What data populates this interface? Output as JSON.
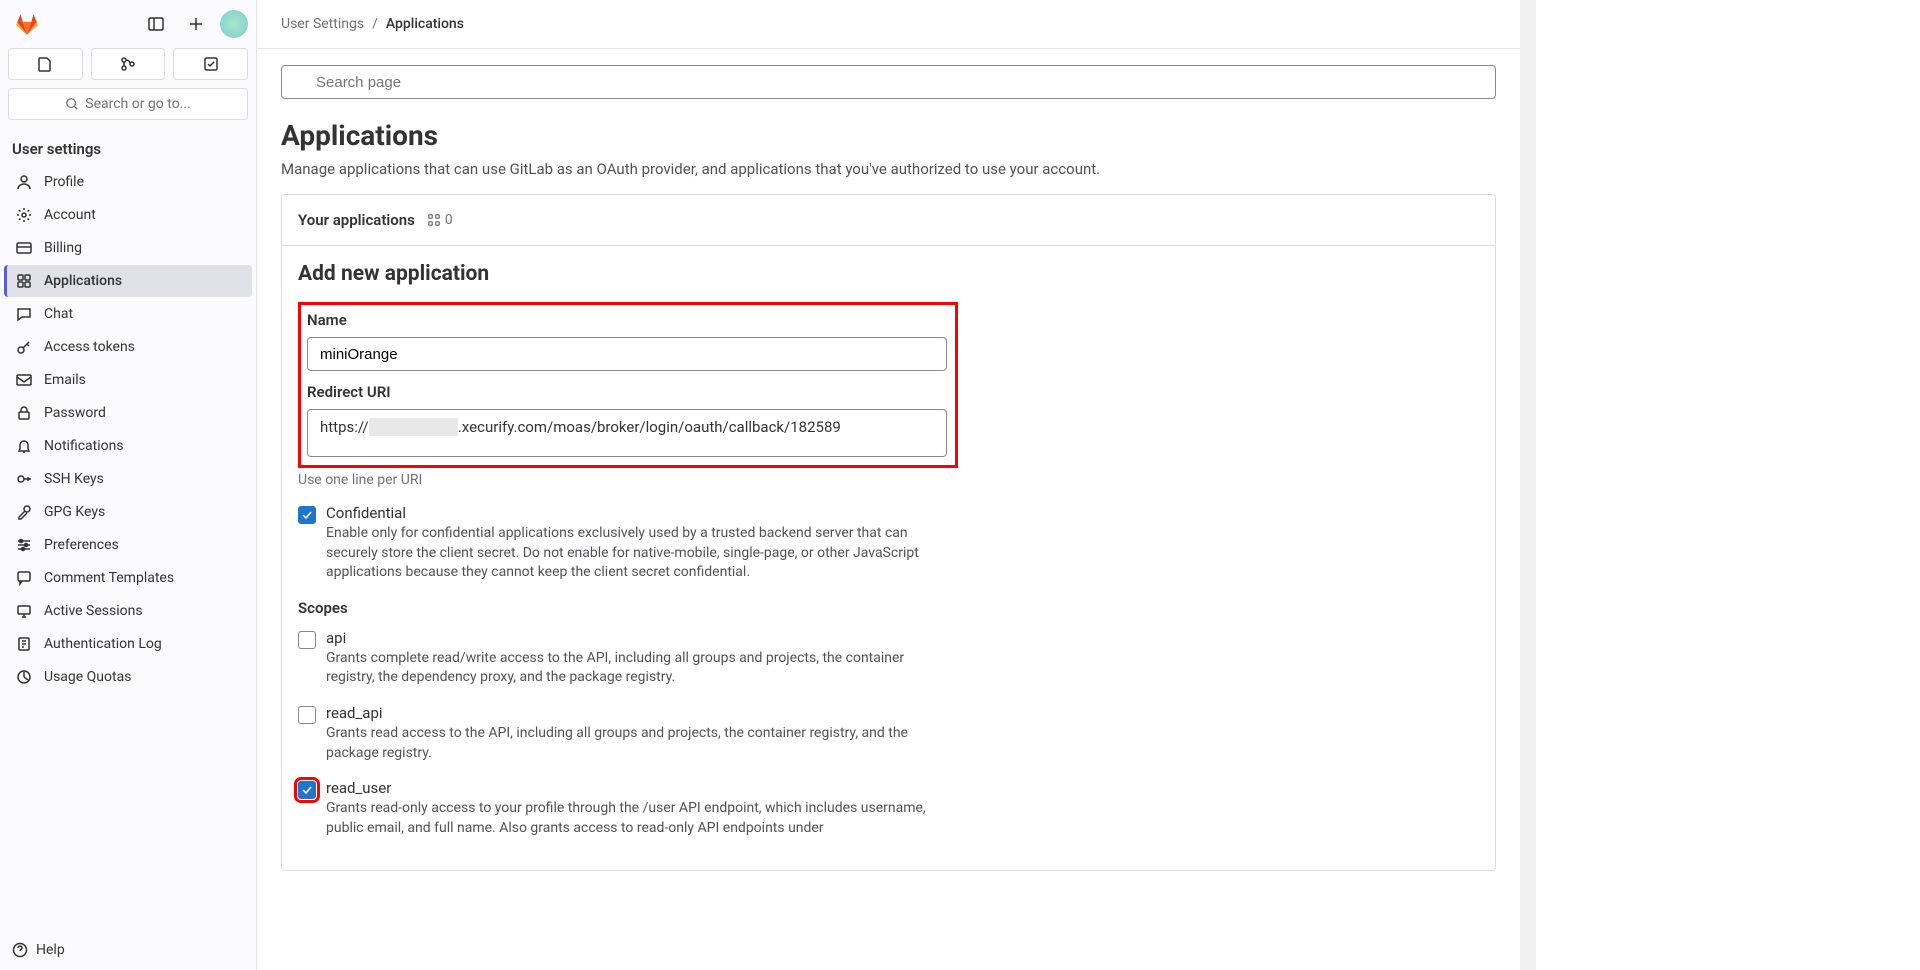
{
  "sidebar": {
    "search_button": "Search or go to...",
    "section_title": "User settings",
    "items": [
      {
        "label": "Profile",
        "icon": "profile"
      },
      {
        "label": "Account",
        "icon": "account"
      },
      {
        "label": "Billing",
        "icon": "billing"
      },
      {
        "label": "Applications",
        "icon": "applications",
        "active": true
      },
      {
        "label": "Chat",
        "icon": "chat"
      },
      {
        "label": "Access tokens",
        "icon": "key"
      },
      {
        "label": "Emails",
        "icon": "mail"
      },
      {
        "label": "Password",
        "icon": "lock"
      },
      {
        "label": "Notifications",
        "icon": "bell"
      },
      {
        "label": "SSH Keys",
        "icon": "key2"
      },
      {
        "label": "GPG Keys",
        "icon": "key3"
      },
      {
        "label": "Preferences",
        "icon": "sliders"
      },
      {
        "label": "Comment Templates",
        "icon": "comment"
      },
      {
        "label": "Active Sessions",
        "icon": "session"
      },
      {
        "label": "Authentication Log",
        "icon": "log"
      },
      {
        "label": "Usage Quotas",
        "icon": "quota"
      }
    ],
    "help": "Help"
  },
  "breadcrumb": {
    "parent": "User Settings",
    "sep": "/",
    "current": "Applications"
  },
  "search": {
    "placeholder": "Search page"
  },
  "page": {
    "title": "Applications",
    "description": "Manage applications that can use GitLab as an OAuth provider, and applications that you've authorized to use your account."
  },
  "card": {
    "header": "Your applications",
    "count": "0",
    "form_title": "Add new application",
    "name_label": "Name",
    "name_value": "miniOrange",
    "redirect_label": "Redirect URI",
    "redirect_value_prefix": "https://",
    "redirect_value_redacted": " ",
    "redirect_value_suffix": ".xecurify.com/moas/broker/login/oauth/callback/182589",
    "redirect_hint": "Use one line per URI",
    "confidential": {
      "label": "Confidential",
      "desc": "Enable only for confidential applications exclusively used by a trusted backend server that can securely store the client secret. Do not enable for native-mobile, single-page, or other JavaScript applications because they cannot keep the client secret confidential."
    },
    "scopes_label": "Scopes",
    "scopes": [
      {
        "name": "api",
        "checked": false,
        "desc": "Grants complete read/write access to the API, including all groups and projects, the container registry, the dependency proxy, and the package registry."
      },
      {
        "name": "read_api",
        "checked": false,
        "desc": "Grants read access to the API, including all groups and projects, the container registry, and the package registry."
      },
      {
        "name": "read_user",
        "checked": true,
        "highlight": true,
        "desc": "Grants read-only access to your profile through the /user API endpoint, which includes username, public email, and full name. Also grants access to read-only API endpoints under"
      }
    ]
  }
}
